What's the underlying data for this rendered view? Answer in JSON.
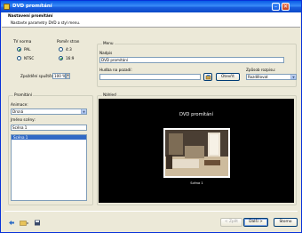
{
  "window": {
    "title": "DVD promítání"
  },
  "header": {
    "title": "Nastavení promítání",
    "subtitle": "Nastavte parametry DVD a styl menu."
  },
  "tv_norm": {
    "label": "TV norma",
    "options": [
      "PAL",
      "NTSC"
    ],
    "selected": "PAL"
  },
  "aspect": {
    "label": "Poměr stran",
    "options": [
      "4:3",
      "16:9"
    ],
    "selected": "16:9"
  },
  "start_delay": {
    "label": "Zpoždění spuštění:",
    "value": "100 %"
  },
  "menu": {
    "group_label": "Menu",
    "title_label": "Nadpis",
    "title_value": "DVD promítání",
    "bg_music_label": "Hudba na pozadí:",
    "bg_music_value": "",
    "browse_label": "Otevřít",
    "transition_label": "Způsob rozpisu:",
    "transition_value": "Rozdělovat"
  },
  "slideshow": {
    "group_label": "Promítání",
    "transition_label": "Animace:",
    "transition_value": "Drsná",
    "name_label": "Jméno scény:",
    "name_value": "Scéna 1",
    "items": [
      "Scéna 1"
    ]
  },
  "preview": {
    "group_label": "Náhled",
    "menu_title": "DVD promítání",
    "thumb_caption": "Scéna 1"
  },
  "buttons": {
    "back": "< Zpět",
    "next": "Další >",
    "cancel": "Storno"
  }
}
